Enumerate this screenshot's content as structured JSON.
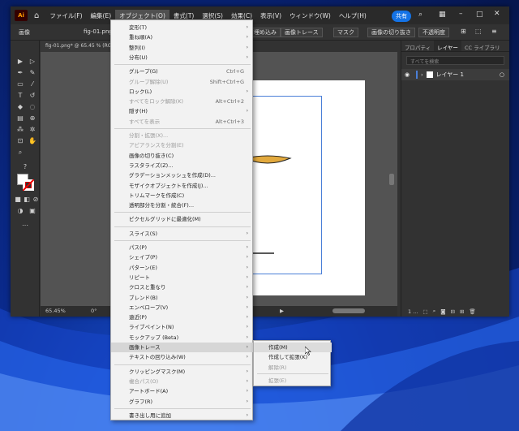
{
  "title_menu": [
    "ファイル(F)",
    "編集(E)",
    "オブジェクト(O)",
    "書式(T)",
    "選択(S)",
    "効果(C)",
    "表示(V)",
    "ウィンドウ(W)",
    "ヘルプ(H)"
  ],
  "share_label": "共有",
  "logo_text": "Ai",
  "control_bar": {
    "left_label": "画像",
    "file_name": "fig-01.png",
    "embed_btn": "て埋め込み",
    "trace_btn": "画像トレース",
    "mask_btn": "マスク",
    "crop_btn": "画像の切り抜き",
    "opacity_btn": "不透明度"
  },
  "doc_tab": "fig-01.png* @ 65.45 % (RGB",
  "status": {
    "zoom": "65.45%",
    "rotate": "0°"
  },
  "panel": {
    "tabs": [
      "プロパティ",
      "レイヤー",
      "CC ライブラリ"
    ],
    "search_placeholder": "すべてを検索",
    "layer_name": "レイヤー 1",
    "footer_count": "1 ..."
  },
  "object_menu": [
    {
      "label": "変形(T)",
      "arrow": true
    },
    {
      "label": "重ね順(A)",
      "arrow": true
    },
    {
      "label": "整列(I)",
      "arrow": true
    },
    {
      "label": "分布(U)",
      "arrow": true
    },
    {
      "sep": true
    },
    {
      "label": "グループ(G)",
      "shortcut": "Ctrl+G"
    },
    {
      "label": "グループ解除(U)",
      "shortcut": "Shift+Ctrl+G",
      "disabled": true
    },
    {
      "label": "ロック(L)",
      "arrow": true
    },
    {
      "label": "すべてをロック解除(K)",
      "shortcut": "Alt+Ctrl+2",
      "disabled": true
    },
    {
      "label": "隠す(H)",
      "arrow": true
    },
    {
      "label": "すべてを表示",
      "shortcut": "Alt+Ctrl+3",
      "disabled": true
    },
    {
      "sep": true
    },
    {
      "label": "分割・拡張(X)...",
      "disabled": true
    },
    {
      "label": "アピアランスを分割(E)",
      "disabled": true
    },
    {
      "label": "画像の切り抜き(C)"
    },
    {
      "label": "ラスタライズ(Z)..."
    },
    {
      "label": "グラデーションメッシュを作成(D)..."
    },
    {
      "label": "モザイクオブジェクトを作成(J)..."
    },
    {
      "label": "トリムマークを作成(C)"
    },
    {
      "label": "透明部分を分割・統合(F)..."
    },
    {
      "sep": true
    },
    {
      "label": "ピクセルグリッドに最適化(M)"
    },
    {
      "sep": true
    },
    {
      "label": "スライス(S)",
      "arrow": true
    },
    {
      "sep": true
    },
    {
      "label": "パス(P)",
      "arrow": true
    },
    {
      "label": "シェイプ(P)",
      "arrow": true
    },
    {
      "label": "パターン(E)",
      "arrow": true
    },
    {
      "label": "リピート",
      "arrow": true
    },
    {
      "label": "クロスと重なり",
      "arrow": true
    },
    {
      "label": "ブレンド(B)",
      "arrow": true
    },
    {
      "label": "エンベロープ(V)",
      "arrow": true
    },
    {
      "label": "遠近(P)",
      "arrow": true
    },
    {
      "label": "ライブペイント(N)",
      "arrow": true
    },
    {
      "label": "モックアップ (Beta)",
      "arrow": true
    },
    {
      "label": "画像トレース",
      "arrow": true,
      "highlight": true
    },
    {
      "label": "テキストの回り込み(W)",
      "arrow": true
    },
    {
      "sep": true
    },
    {
      "label": "クリッピングマスク(M)",
      "arrow": true
    },
    {
      "label": "複合パス(O)",
      "arrow": true,
      "disabled": true
    },
    {
      "label": "アートボード(A)",
      "arrow": true
    },
    {
      "label": "グラフ(R)",
      "arrow": true
    },
    {
      "sep": true
    },
    {
      "label": "書き出し用に追加",
      "arrow": true
    }
  ],
  "trace_submenu": [
    {
      "label": "作成(M)",
      "highlight": true
    },
    {
      "label": "作成して拡張(K)"
    },
    {
      "label": "解除(R)",
      "disabled": true
    },
    {
      "sep": true
    },
    {
      "label": "拡張(E)",
      "disabled": true
    }
  ]
}
